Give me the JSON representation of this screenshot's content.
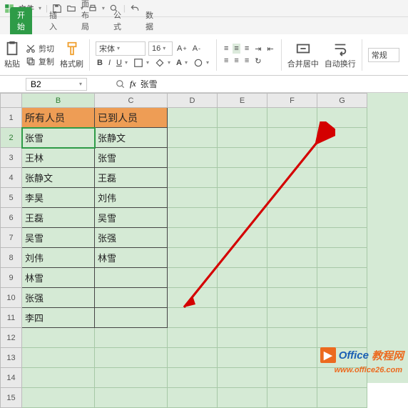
{
  "menu": {
    "file": "文件"
  },
  "tabs": {
    "start": "开始",
    "insert": "插入",
    "pagelayout": "页面布局",
    "formula": "公式",
    "data": "数据"
  },
  "ribbon": {
    "paste": "粘贴",
    "cut": "剪切",
    "copy": "复制",
    "format_painter": "格式刷",
    "font_name": "宋体",
    "font_size": "16",
    "merge": "合并居中",
    "wrap": "自动换行",
    "general": "常规"
  },
  "cellref": "B2",
  "fx_value": "张雪",
  "cols": [
    "B",
    "C",
    "D",
    "E",
    "F",
    "G"
  ],
  "rows": [
    "1",
    "2",
    "3",
    "4",
    "5",
    "6",
    "7",
    "8",
    "9",
    "10",
    "11",
    "12",
    "13",
    "14",
    "15"
  ],
  "grid": {
    "header_b": "所有人员",
    "header_c": "已到人员",
    "b": [
      "张雪",
      "王林",
      "张静文",
      "李昊",
      "王磊",
      "吴雪",
      "刘伟",
      "林雪",
      "张强",
      "李四"
    ],
    "c": [
      "张静文",
      "张雪",
      "王磊",
      "刘伟",
      "吴雪",
      "张强",
      "林雪",
      "",
      "",
      ""
    ]
  },
  "watermark": {
    "t1": "Office",
    "t2": "教程网",
    "url": "www.office26.com"
  }
}
